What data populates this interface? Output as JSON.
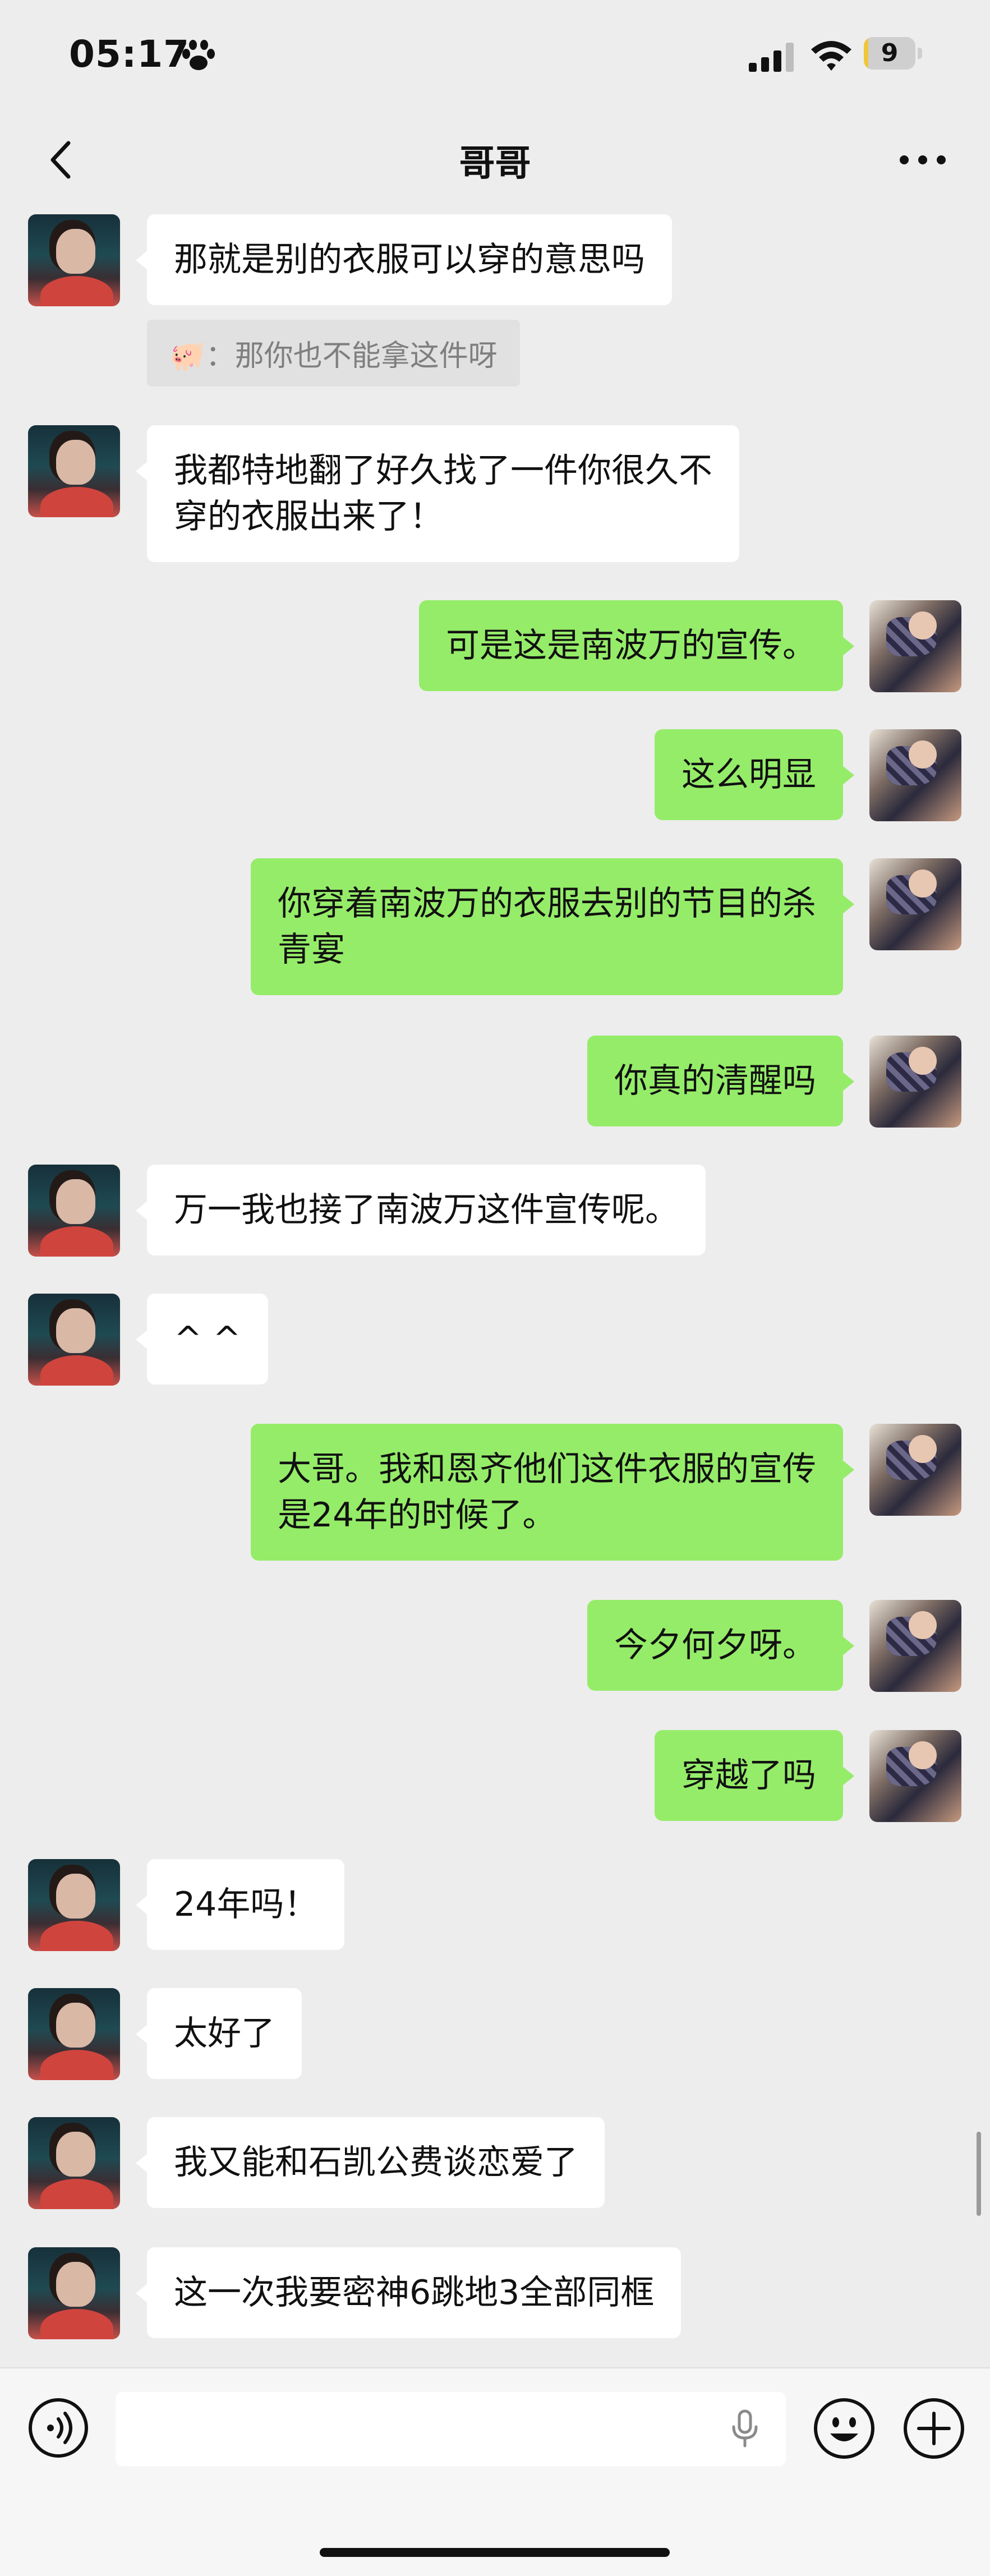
{
  "status_bar": {
    "time": "05:17",
    "battery": "9",
    "battery_level": 0.09
  },
  "nav": {
    "title": "哥哥"
  },
  "messages": [
    {
      "side": "left",
      "text": "那就是别的衣服可以穿的意思吗"
    },
    {
      "side": "quote",
      "emoji": "🐖",
      "text": "：那你也不能拿这件呀"
    },
    {
      "side": "left",
      "text": "我都特地翻了好久找了一件你很久不\n穿的衣服出来了！"
    },
    {
      "side": "right",
      "text": "可是这是南波万的宣传。"
    },
    {
      "side": "right",
      "text": "这么明显"
    },
    {
      "side": "right",
      "text": "你穿着南波万的衣服去别的节目的杀\n青宴"
    },
    {
      "side": "right",
      "text": "你真的清醒吗"
    },
    {
      "side": "left",
      "text": "万一我也接了南波万这件宣传呢。"
    },
    {
      "side": "left",
      "text": "^ ^"
    },
    {
      "side": "right",
      "text": "大哥。我和恩齐他们这件衣服的宣传\n是24年的时候了。"
    },
    {
      "side": "right",
      "text": "今夕何夕呀。"
    },
    {
      "side": "right",
      "text": "穿越了吗"
    },
    {
      "side": "left",
      "text": "24年吗！"
    },
    {
      "side": "left",
      "text": "太好了"
    },
    {
      "side": "left",
      "text": "我又能和石凯公费谈恋爱了"
    },
    {
      "side": "left",
      "text": "这一次我要密神6跳地3全部同框"
    }
  ],
  "colors": {
    "bubble_right": "#95ec69",
    "bubble_left": "#ffffff",
    "background": "#ededed"
  },
  "icons": [
    "back-chevron-icon",
    "more-dots-icon",
    "voice-icon",
    "microphone-icon",
    "emoji-icon",
    "plus-icon",
    "paw-icon",
    "signal-icon",
    "wifi-icon",
    "battery-icon"
  ]
}
